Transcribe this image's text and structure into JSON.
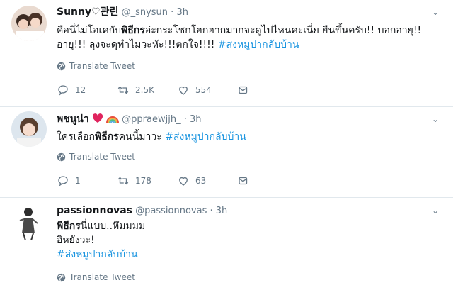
{
  "tweets": [
    {
      "name": "Sunny♡관린",
      "handle": "@_snysun",
      "time": "3h",
      "lines": [
        {
          "a": "คือนี่ไม่โอเคกับ",
          "b": "พิธีกร",
          "c": "อ่ะกระโชกโฮกฮากมากจะดูไปไหนคะเนี่ย ยืนขึ้นครับ!! บอกอายุ!!"
        },
        {
          "a": "อายุ!!! ลุงจะดุทำไมวะหัะ!!!ตกใจ!!!! ",
          "tag": "#ส่งหมูปากลับบ้าน"
        }
      ],
      "translate": "Translate Tweet",
      "replies": "12",
      "retweets": "2.5K",
      "likes": "554"
    },
    {
      "name": "พชนูน่า",
      "handle": "@ppraewjjh_",
      "time": "3h",
      "lines": [
        {
          "a": "ใครเลือก",
          "b": "พิธีกร",
          "c": "คนนี้มาวะ ",
          "tag": "#ส่งหมูปากลับบ้าน"
        }
      ],
      "translate": "Translate Tweet",
      "replies": "1",
      "retweets": "178",
      "likes": "63"
    },
    {
      "name": "passionnovas",
      "handle": "@passionnovas",
      "time": "3h",
      "lines": [
        {
          "b": "พิธีกร",
          "c": "นี่แบบ..หึมมมม"
        },
        {
          "a": "อิหยังวะ!"
        },
        {
          "tag": "#ส่งหมูปากลับบ้าน"
        }
      ],
      "translate": "Translate Tweet"
    }
  ],
  "colors": {
    "link": "#1b95e0",
    "muted": "#657786",
    "heart": "#e0245e",
    "divider": "#e1e8ed"
  }
}
